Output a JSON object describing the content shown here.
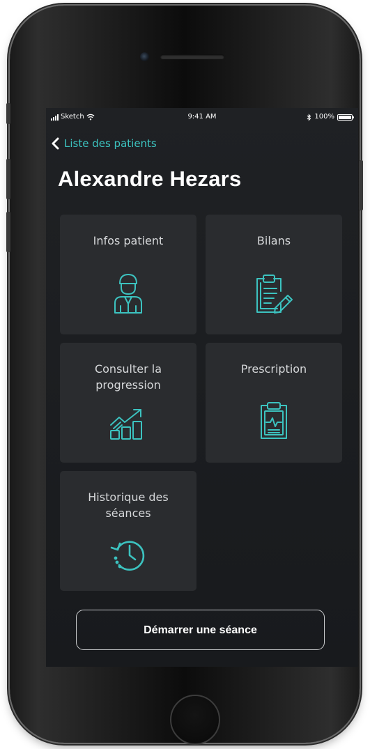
{
  "status_bar": {
    "carrier": "Sketch",
    "time": "9:41 AM",
    "battery": "100%",
    "icons": [
      "signal-icon",
      "wifi-icon",
      "bluetooth-icon",
      "battery-icon"
    ]
  },
  "nav": {
    "back_label": "Liste des patients",
    "back_icon": "chevron-left-icon"
  },
  "patient": {
    "name": "Alexandre Hezars"
  },
  "tiles": [
    {
      "label": "Infos patient",
      "icon": "patient-icon"
    },
    {
      "label": "Bilans",
      "icon": "clipboard-pen-icon"
    },
    {
      "label": "Consulter la progression",
      "icon": "growth-chart-icon"
    },
    {
      "label": "Prescription",
      "icon": "clipboard-pulse-icon"
    },
    {
      "label": "Historique des séances",
      "icon": "history-clock-icon"
    }
  ],
  "cta": {
    "label": "Démarrer une séance"
  },
  "colors": {
    "accent": "#3cc3c0",
    "screen_bg": "#1c1e21",
    "tile_bg": "#2a2c2f",
    "text": "#ffffff"
  }
}
